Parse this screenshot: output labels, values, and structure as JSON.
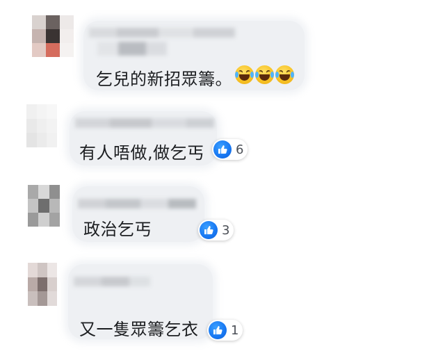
{
  "comments": [
    {
      "text": "乞兒的新招眾籌。",
      "reactions": [
        "haha-icon",
        "haha-icon",
        "haha-icon"
      ],
      "count": ""
    },
    {
      "text": "有人唔做,做乞丐",
      "reactions": [
        "like-icon"
      ],
      "count": "6"
    },
    {
      "text": "政治乞丐",
      "reactions": [
        "like-icon"
      ],
      "count": "3"
    },
    {
      "text": "又一隻眾籌乞衣",
      "reactions": [
        "like-icon"
      ],
      "count": "1"
    }
  ],
  "colors": {
    "like": "#1877f2",
    "bubble": "#eef0f3",
    "text": "#1c1e21"
  }
}
